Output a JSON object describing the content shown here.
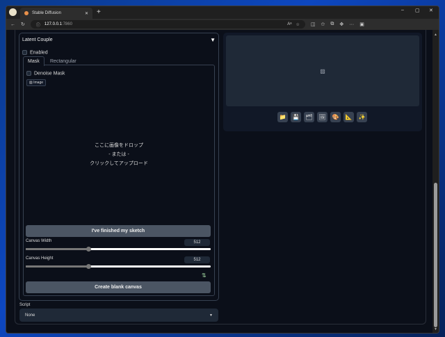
{
  "browser": {
    "tab_title": "Stable Diffusion",
    "url_host": "127.0.0.1",
    "url_port": ":7860"
  },
  "latent_couple": {
    "title": "Latent Couple",
    "enabled_label": "Enabled",
    "tabs": [
      "Mask",
      "Rectangular"
    ],
    "denoise_label": "Denoise Mask",
    "image_label": "Image",
    "drop_text": [
      "ここに画像をドロップ",
      "- または -",
      "クリックしてアップロード"
    ],
    "finish_button": "I've finished my sketch",
    "canvas_width_label": "Canvas Width",
    "canvas_width": "512",
    "canvas_width_fraction": 0.34,
    "canvas_height_label": "Canvas Height",
    "canvas_height": "512",
    "canvas_height_fraction": 0.34,
    "swap_icon": "⇅",
    "create_button": "Create blank canvas"
  },
  "script": {
    "label": "Script",
    "value": "None"
  },
  "tools": [
    {
      "name": "folder-icon",
      "glyph": "📁"
    },
    {
      "name": "save-icon",
      "glyph": "💾"
    },
    {
      "name": "zip-icon",
      "glyph": "🗂"
    },
    {
      "name": "image-icon",
      "glyph": "🖼"
    },
    {
      "name": "palette-icon",
      "glyph": "🎨"
    },
    {
      "name": "ruler-icon",
      "glyph": "📐"
    },
    {
      "name": "sparkle-icon",
      "glyph": "✨"
    }
  ]
}
